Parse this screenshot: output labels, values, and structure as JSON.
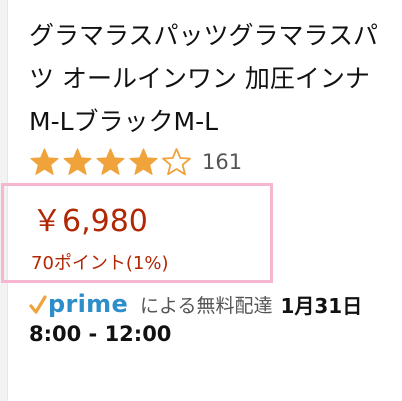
{
  "product": {
    "title_lines": [
      "グラマラスパッツグラマラスパ",
      "ツ オールインワン 加圧インナ",
      "M-LブラックM-L"
    ]
  },
  "rating": {
    "stars": 4,
    "max_stars": 5,
    "review_count": "161",
    "star_color": "#f0a23b"
  },
  "price": {
    "amount": "￥6,980",
    "points": "70ポイント(1%)",
    "color": "#b12704",
    "box_border_color": "#f7b6cf"
  },
  "delivery": {
    "prime_label": "prime",
    "prime_check_icon": "checkmark-icon",
    "prime_color": "#2d8ec9",
    "prime_check_color": "#f0a23b",
    "text": "による無料配達",
    "date": "1月31日",
    "time": "8:00 - 12:00"
  }
}
